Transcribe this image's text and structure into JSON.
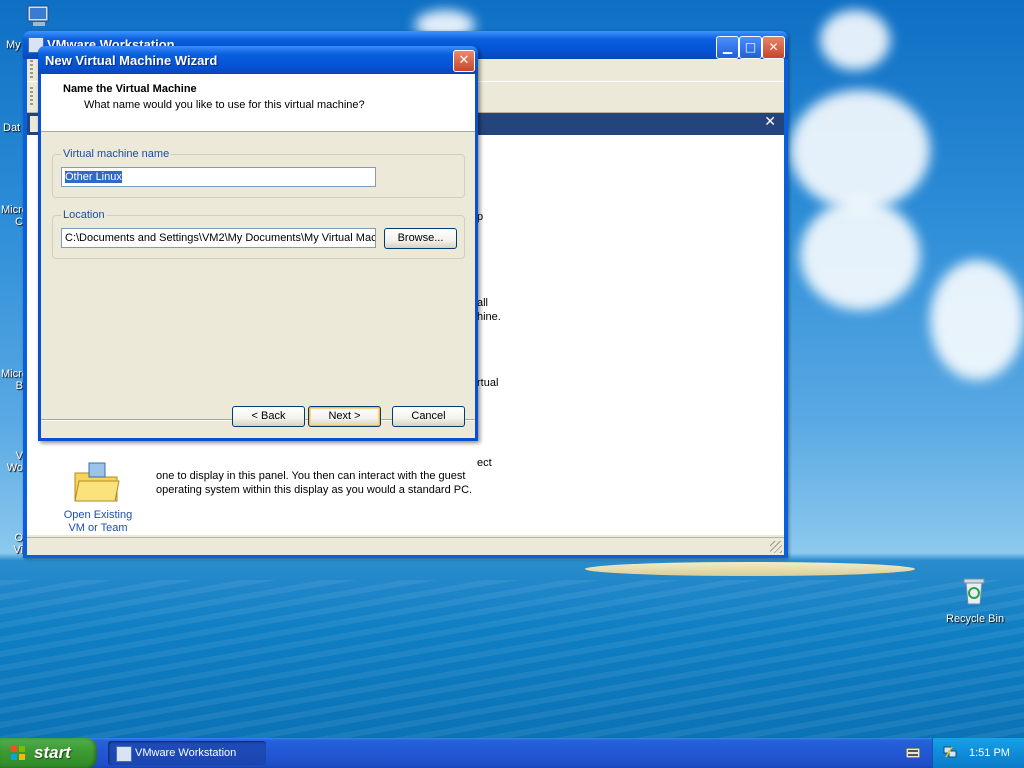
{
  "desktop": {
    "left_icon_labels": [
      "My",
      "Dat",
      "Micro\nC",
      "Micro\nB",
      "V\nWo",
      "O\nVi"
    ],
    "recycle_bin_label": "Recycle Bin"
  },
  "vmware_window": {
    "title": "VMware Workstation",
    "help_text_fragments": [
      "p",
      "all",
      "hine.",
      "rtual",
      "ect"
    ],
    "help_text_lines": [
      "one to display in this panel. You then can interact with the guest",
      "operating system within this display as you would a standard PC."
    ],
    "open_existing_label_1": "Open Existing",
    "open_existing_label_2": "VM or Team"
  },
  "wizard": {
    "title": "New Virtual Machine Wizard",
    "header_title": "Name the Virtual Machine",
    "header_subtitle": "What name would you like to use for this virtual machine?",
    "vm_name_label": "Virtual machine name",
    "vm_name_value": "Other Linux",
    "location_label": "Location",
    "location_value": "C:\\Documents and Settings\\VM2\\My Documents\\My Virtual Mac",
    "browse_label": "Browse...",
    "back_label": "< Back",
    "next_label": "Next >",
    "cancel_label": "Cancel"
  },
  "taskbar": {
    "start_label": "start",
    "task_label": "VMware Workstation",
    "clock": "1:51 PM"
  },
  "icons": [
    "close-icon",
    "minimize-icon",
    "maximize-icon",
    "home-icon",
    "folder-icon",
    "recycle-bin-icon",
    "windows-flag-icon",
    "keyboard-icon",
    "network-icon"
  ]
}
